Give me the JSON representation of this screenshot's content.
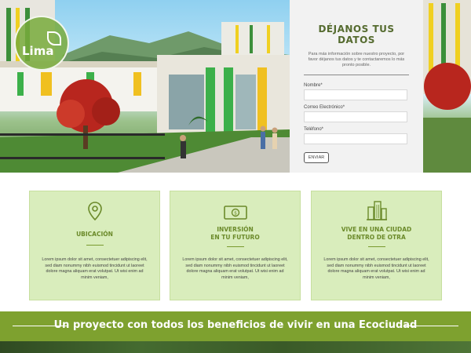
{
  "hero": {
    "logo_text": "Lima",
    "form": {
      "title": "DÉJANOS TUS DATOS",
      "description": "Para más información sobre nuestro proyecto, por favor déjanos tus datos y te contactaremos lo más pronto posible.",
      "fields": [
        {
          "label": "Nombre*",
          "value": ""
        },
        {
          "label": "Correo Electrónico*",
          "value": ""
        },
        {
          "label": "Teléfono*",
          "value": ""
        }
      ],
      "submit_label": "ENVIAR"
    }
  },
  "features": [
    {
      "icon": "location-pin-icon",
      "title_line1": "UBICACIÓN",
      "title_line2": "",
      "body": "Lorem ipsum dolor sit amet, consectetuer adipiscing elit, sed diam nonummy nibh euismod tincidunt ut laoreet dolore magna aliquam erat volutpat. Ut wisi enim ad minim veniam,"
    },
    {
      "icon": "money-bill-icon",
      "title_line1": "INVERSIÓN",
      "title_line2": "EN TU FUTURO",
      "body": "Lorem ipsum dolor sit amet, consectetuer adipiscing elit, sed diam nonummy nibh euismod tincidunt ut laoreet dolore magna aliquam erat volutpat. Ut wisi enim ad minim veniam,"
    },
    {
      "icon": "buildings-icon",
      "title_line1": "VIVE EN UNA CIUDAD",
      "title_line2": "DENTRO DE OTRA",
      "body": "Lorem ipsum dolor sit amet, consectetuer adipiscing elit, sed diam nonummy nibh euismod tincidunt ut laoreet dolore magna aliquam erat volutpat. Ut wisi enim ad minim veniam,"
    }
  ],
  "banner": {
    "text": "Un proyecto con todos los beneficios de vivir en una Ecociudad"
  },
  "colors": {
    "accent_green": "#7ea12f",
    "card_bg": "#d9edbc",
    "title_green": "#556b2f"
  }
}
